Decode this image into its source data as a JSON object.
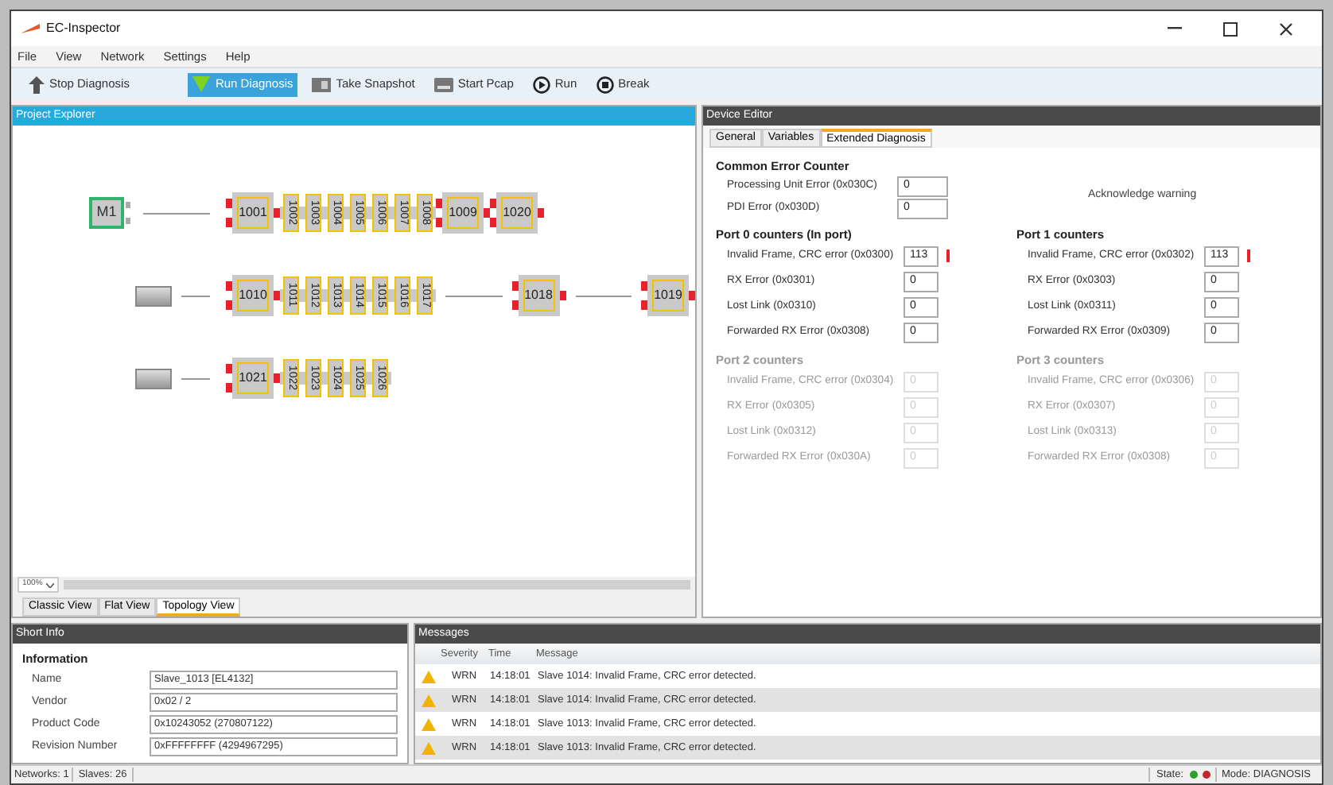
{
  "window": {
    "title": "EC-Inspector"
  },
  "menu": [
    "File",
    "View",
    "Network",
    "Settings",
    "Help"
  ],
  "toolbar": [
    {
      "label": "Stop Diagnosis",
      "kind": "stop",
      "selected": false
    },
    {
      "label": "Run Diagnosis",
      "kind": "run-diag",
      "selected": true
    },
    {
      "label": "Take Snapshot",
      "kind": "snapshot",
      "selected": false
    },
    {
      "label": "Start Pcap",
      "kind": "pcap",
      "selected": false
    },
    {
      "label": "Run",
      "kind": "play",
      "selected": false
    },
    {
      "label": "Break",
      "kind": "pause",
      "selected": false
    }
  ],
  "project_explorer": {
    "title": "Project Explorer",
    "lines": [
      {
        "head": {
          "kind": "master",
          "label": "M1"
        },
        "nodes": [
          {
            "kind": "big",
            "label": "1001"
          },
          {
            "kind": "small",
            "label": "1002"
          },
          {
            "kind": "small",
            "label": "1003"
          },
          {
            "kind": "small",
            "label": "1004"
          },
          {
            "kind": "small",
            "label": "1005"
          },
          {
            "kind": "small",
            "label": "1006"
          },
          {
            "kind": "small",
            "label": "1007"
          },
          {
            "kind": "small",
            "label": "1008"
          },
          {
            "kind": "big",
            "label": "1009"
          },
          {
            "kind": "big",
            "label": "1020"
          }
        ]
      },
      {
        "head": {
          "kind": "coupler"
        },
        "nodes": [
          {
            "kind": "big",
            "label": "1010"
          },
          {
            "kind": "small",
            "label": "1011"
          },
          {
            "kind": "small",
            "label": "1012"
          },
          {
            "kind": "small",
            "label": "1013"
          },
          {
            "kind": "small",
            "label": "1014"
          },
          {
            "kind": "small",
            "label": "1015"
          },
          {
            "kind": "small",
            "label": "1016"
          },
          {
            "kind": "small",
            "label": "1017"
          },
          {
            "kind": "link"
          },
          {
            "kind": "big",
            "label": "1018"
          },
          {
            "kind": "link"
          },
          {
            "kind": "big",
            "label": "1019"
          }
        ]
      },
      {
        "head": {
          "kind": "coupler"
        },
        "nodes": [
          {
            "kind": "big",
            "label": "1021"
          },
          {
            "kind": "small",
            "label": "1022"
          },
          {
            "kind": "small",
            "label": "1023"
          },
          {
            "kind": "small",
            "label": "1024"
          },
          {
            "kind": "small",
            "label": "1025"
          },
          {
            "kind": "small",
            "label": "1026"
          }
        ]
      }
    ],
    "zoom": "100%",
    "tabs": [
      {
        "label": "Classic View",
        "selected": false
      },
      {
        "label": "Flat View",
        "selected": false
      },
      {
        "label": "Topology View",
        "selected": true
      }
    ]
  },
  "device_editor": {
    "title": "Device Editor",
    "tabs": [
      {
        "label": "General",
        "selected": false
      },
      {
        "label": "Variables",
        "selected": false
      },
      {
        "label": "Extended Diagnosis",
        "selected": true
      }
    ],
    "common": {
      "title": "Common Error Counter",
      "counters": [
        {
          "label": "Processing Unit Error (0x030C)",
          "value": "0"
        },
        {
          "label": "PDI Error (0x030D)",
          "value": "0"
        }
      ],
      "action": "Acknowledge warning"
    },
    "ports": [
      {
        "title": "Port 0 counters (In port)",
        "disabled": false,
        "counters": [
          {
            "label": "Invalid Frame, CRC error (0x0300)",
            "value": "113",
            "warning": true
          },
          {
            "label": "RX Error (0x0301)",
            "value": "0",
            "warning": false
          },
          {
            "label": "Lost Link (0x0310)",
            "value": "0",
            "warning": false
          },
          {
            "label": "Forwarded RX Error (0x0308)",
            "value": "0",
            "warning": false
          }
        ]
      },
      {
        "title": "Port 1 counters",
        "disabled": false,
        "counters": [
          {
            "label": "Invalid Frame, CRC error (0x0302)",
            "value": "113",
            "warning": true
          },
          {
            "label": "RX Error (0x0303)",
            "value": "0",
            "warning": false
          },
          {
            "label": "Lost Link (0x0311)",
            "value": "0",
            "warning": false
          },
          {
            "label": "Forwarded RX Error (0x0309)",
            "value": "0",
            "warning": false
          }
        ]
      },
      {
        "title": "Port 2 counters",
        "disabled": true,
        "counters": [
          {
            "label": "Invalid Frame, CRC error (0x0304)",
            "value": "0",
            "warning": false
          },
          {
            "label": "RX Error (0x0305)",
            "value": "0",
            "warning": false
          },
          {
            "label": "Lost Link (0x0312)",
            "value": "0",
            "warning": false
          },
          {
            "label": "Forwarded RX Error (0x030A)",
            "value": "0",
            "warning": false
          }
        ]
      },
      {
        "title": "Port 3 counters",
        "disabled": true,
        "counters": [
          {
            "label": "Invalid Frame, CRC error (0x0306)",
            "value": "0",
            "warning": false
          },
          {
            "label": "RX Error (0x0307)",
            "value": "0",
            "warning": false
          },
          {
            "label": "Lost Link (0x0313)",
            "value": "0",
            "warning": false
          },
          {
            "label": "Forwarded RX Error (0x0308)",
            "value": "0",
            "warning": false
          }
        ]
      }
    ]
  },
  "short_info": {
    "title": "Short Info",
    "heading": "Information",
    "fields": [
      {
        "label": "Name",
        "value": "Slave_1013 [EL4132]"
      },
      {
        "label": "Vendor",
        "value": "0x02 / 2"
      },
      {
        "label": "Product Code",
        "value": "0x10243052 (270807122)"
      },
      {
        "label": "Revision Number",
        "value": "0xFFFFFFFF (4294967295)"
      }
    ]
  },
  "messages": {
    "title": "Messages",
    "columns": [
      "Severity",
      "Time",
      "Message"
    ],
    "rows": [
      {
        "severity": "WRN",
        "time": "14:18:01",
        "message": "Slave 1014: Invalid Frame, CRC error detected."
      },
      {
        "severity": "WRN",
        "time": "14:18:01",
        "message": "Slave 1014: Invalid Frame, CRC error detected."
      },
      {
        "severity": "WRN",
        "time": "14:18:01",
        "message": "Slave 1013: Invalid Frame, CRC error detected."
      },
      {
        "severity": "WRN",
        "time": "14:18:01",
        "message": "Slave 1013: Invalid Frame, CRC error detected."
      }
    ]
  },
  "status_bar": {
    "networks": "Networks: 1",
    "slaves": "Slaves: 26",
    "state_label": "State:",
    "state_dots": [
      {
        "color": "#2e9e2e"
      },
      {
        "color": "#c0282d"
      }
    ],
    "mode": "Mode: DIAGNOSIS"
  }
}
